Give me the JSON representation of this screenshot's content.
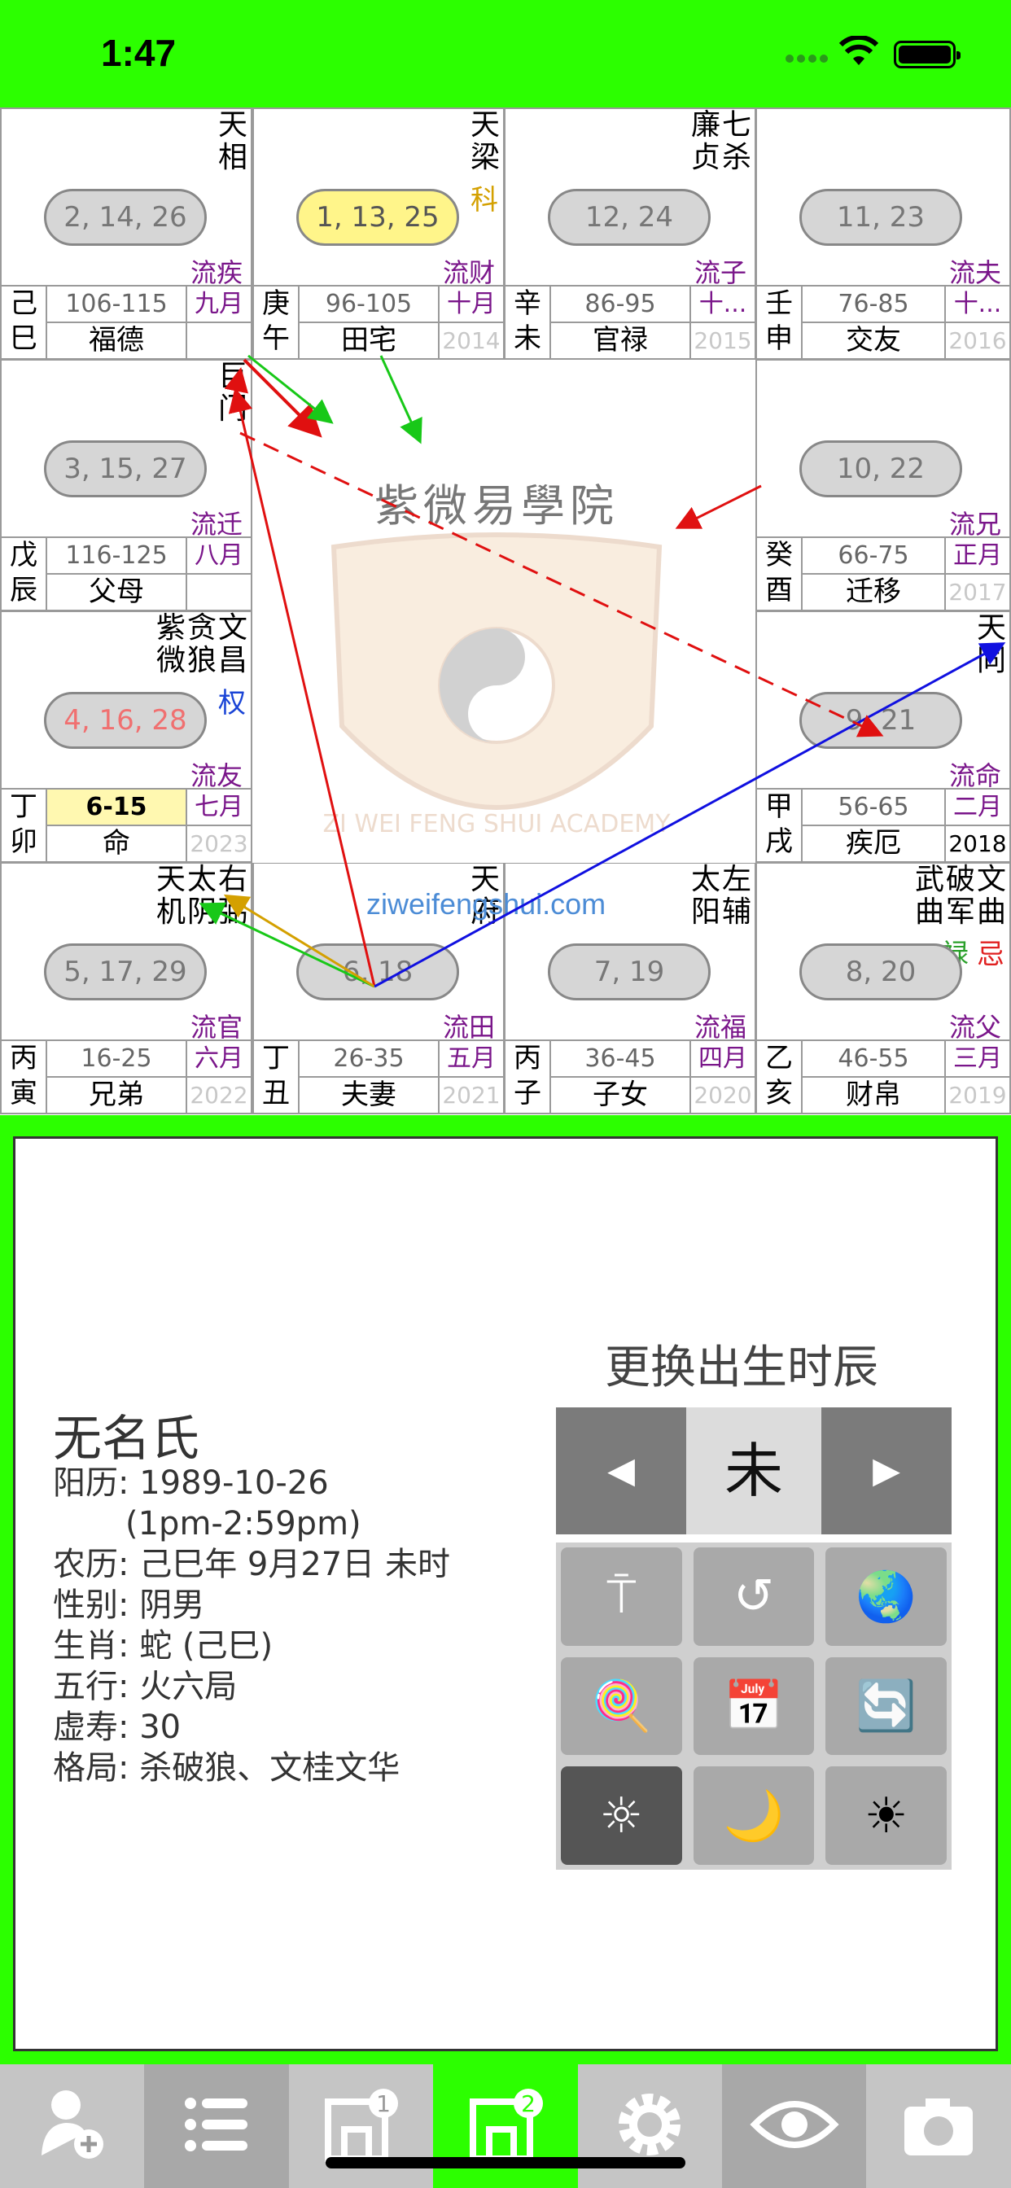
{
  "status": {
    "time": "1:47"
  },
  "cells": [
    {
      "id": "si",
      "stars": [
        "天相"
      ],
      "hua": [],
      "ages": "2, 14, 26",
      "ages_red": false,
      "pill_yellow": false,
      "flow": "流疾",
      "gz": "己巳",
      "range": "106-115",
      "palace": "福德",
      "month": "九月",
      "year": ""
    },
    {
      "id": "wu",
      "stars": [
        "天梁"
      ],
      "hua": [
        {
          "t": "科",
          "c": "#d4a000"
        }
      ],
      "ages": "1, 13, 25",
      "ages_red": false,
      "pill_yellow": true,
      "flow": "流财",
      "gz": "庚午",
      "range": "96-105",
      "palace": "田宅",
      "month": "十月",
      "year": "2014"
    },
    {
      "id": "wei",
      "stars": [
        "七杀",
        "廉贞"
      ],
      "hua": [],
      "ages": "12, 24",
      "ages_red": false,
      "pill_yellow": false,
      "flow": "流子",
      "gz": "辛未",
      "range": "86-95",
      "palace": "官禄",
      "month": "十...",
      "year": "2015"
    },
    {
      "id": "shen",
      "stars": [],
      "hua": [],
      "ages": "11, 23",
      "ages_red": false,
      "pill_yellow": false,
      "flow": "流夫",
      "gz": "壬申",
      "range": "76-85",
      "palace": "交友",
      "month": "十...",
      "year": "2016"
    },
    {
      "id": "chen",
      "stars": [
        "巨门"
      ],
      "hua": [],
      "ages": "3, 15, 27",
      "ages_red": false,
      "pill_yellow": false,
      "flow": "流迁",
      "gz": "戊辰",
      "range": "116-125",
      "palace": "父母",
      "month": "八月",
      "year": ""
    },
    {
      "id": "you",
      "stars": [],
      "hua": [],
      "ages": "10, 22",
      "ages_red": false,
      "pill_yellow": false,
      "flow": "流兄",
      "gz": "癸酉",
      "range": "66-75",
      "palace": "迁移",
      "month": "正月",
      "year": "2017"
    },
    {
      "id": "mao",
      "stars": [
        "文昌",
        "贪狼",
        "紫微"
      ],
      "hua": [
        {
          "t": "权",
          "c": "#1a44d6"
        }
      ],
      "ages": "4, 16, 28",
      "ages_red": true,
      "pill_yellow": false,
      "flow": "流友",
      "gz": "丁卯",
      "range": "6-15",
      "palace": "命",
      "month": "七月",
      "year": "2023"
    },
    {
      "id": "xu",
      "stars": [
        "天同"
      ],
      "hua": [],
      "ages": "9, 21",
      "ages_red": false,
      "pill_yellow": false,
      "flow": "流命",
      "gz": "甲戌",
      "range": "56-65",
      "palace": "疾厄",
      "month": "二月",
      "year": "2018"
    },
    {
      "id": "yin",
      "stars": [
        "右弼",
        "太阴",
        "天机"
      ],
      "hua": [],
      "ages": "5, 17, 29",
      "ages_red": false,
      "pill_yellow": false,
      "flow": "流官",
      "gz": "丙寅",
      "range": "16-25",
      "palace": "兄弟",
      "month": "六月",
      "year": "2022"
    },
    {
      "id": "chou",
      "stars": [
        "天府"
      ],
      "hua": [],
      "ages": "6, 18",
      "ages_red": false,
      "pill_yellow": false,
      "flow": "流田",
      "gz": "丁丑",
      "range": "26-35",
      "palace": "夫妻",
      "month": "五月",
      "year": "2021"
    },
    {
      "id": "zi",
      "stars": [
        "左辅",
        "太阳"
      ],
      "hua": [],
      "ages": "7, 19",
      "ages_red": false,
      "pill_yellow": false,
      "flow": "流福",
      "gz": "丙子",
      "range": "36-45",
      "palace": "子女",
      "month": "四月",
      "year": "2020"
    },
    {
      "id": "hai",
      "stars": [
        "文曲",
        "破军",
        "武曲"
      ],
      "hua": [
        {
          "t": "忌",
          "c": "#e02020"
        },
        {
          "t": "禄",
          "c": "#2aa02a"
        }
      ],
      "ages": "8, 20",
      "ages_red": false,
      "pill_yellow": false,
      "flow": "流父",
      "gz": "乙亥",
      "range": "46-55",
      "palace": "财帛",
      "month": "三月",
      "year": "2019"
    }
  ],
  "watermark": {
    "title": "紫微易學院",
    "site": "ziweifengshui.com",
    "emblem_text": "ZI WEI FENG SHUI ACADEMY"
  },
  "person": {
    "name": "无名氏",
    "solar": "阳历: 1989-10-26",
    "solar_time": "       (1pm-2:59pm)",
    "lunar": "农历: 己巳年 9月27日 未时",
    "gender": "性别: 阴男",
    "zodiac": "生肖: 蛇 (己巳)",
    "element": "五行: 火六局",
    "age": "虚寿: 30",
    "pattern": "格局: 杀破狼、文桂文华"
  },
  "hour_changer": {
    "title": "更换出生时辰",
    "prev": "◀",
    "value": "未",
    "next": "▶"
  },
  "tools": [
    {
      "name": "pin-icon",
      "glyph": "⍑",
      "dark": false
    },
    {
      "name": "history-icon",
      "glyph": "↺",
      "dark": false
    },
    {
      "name": "globe-icon",
      "glyph": "🌏",
      "dark": false
    },
    {
      "name": "lollipop-icon",
      "glyph": "🍭",
      "dark": false
    },
    {
      "name": "calendar-icon",
      "glyph": "📅",
      "dark": false
    },
    {
      "name": "refresh-icon",
      "glyph": "🔄",
      "dark": false
    },
    {
      "name": "brightness-icon",
      "glyph": "☼",
      "dark": true
    },
    {
      "name": "moon-icon",
      "glyph": "🌙",
      "dark": false
    },
    {
      "name": "sun-icon",
      "glyph": "☀",
      "dark": false
    }
  ],
  "tabs": [
    {
      "name": "add-person-icon",
      "selected": false
    },
    {
      "name": "list-icon",
      "selected": false
    },
    {
      "name": "chart-1-icon",
      "selected": false
    },
    {
      "name": "chart-2-icon",
      "selected": true
    },
    {
      "name": "settings-icon",
      "selected": false
    },
    {
      "name": "eye-icon",
      "selected": false
    },
    {
      "name": "camera-icon",
      "selected": false
    }
  ]
}
